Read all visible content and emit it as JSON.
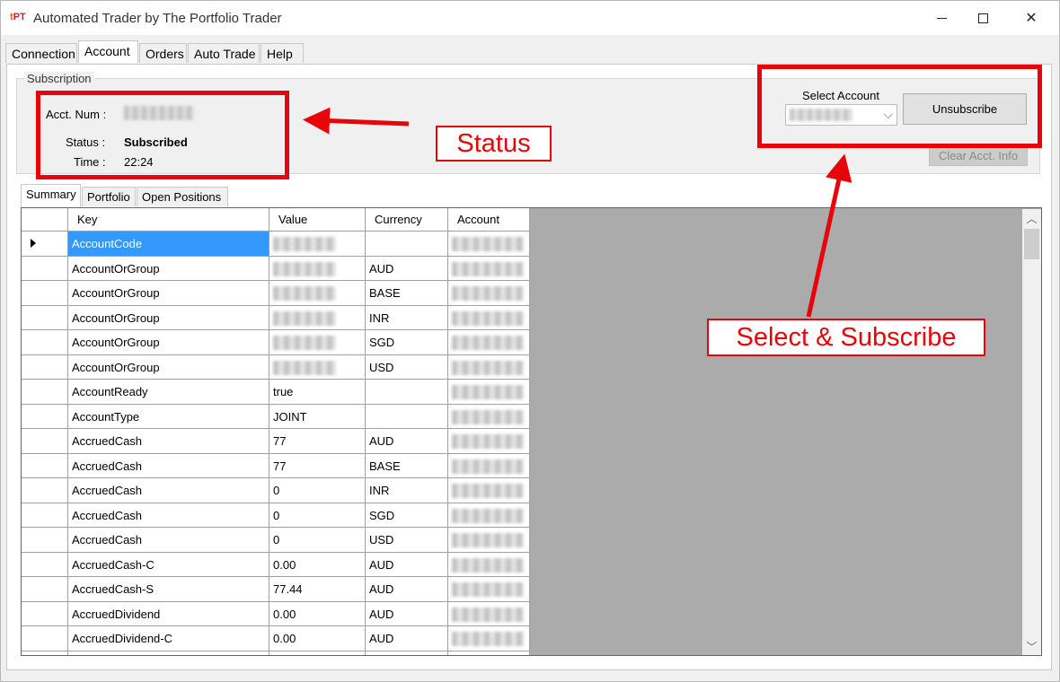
{
  "window": {
    "logo_a": "t",
    "logo_b": "PT",
    "title": "Automated Trader by The Portfolio Trader"
  },
  "tabs": [
    {
      "label": "Connection"
    },
    {
      "label": "Account"
    },
    {
      "label": "Orders"
    },
    {
      "label": "Auto Trade"
    },
    {
      "label": "Help"
    }
  ],
  "subscription": {
    "legend": "Subscription",
    "acct_num_label": "Acct. Num :",
    "status_label": "Status :",
    "status_value": "Subscribed",
    "time_label": "Time :",
    "time_value": "22:24",
    "select_account_label": "Select Account",
    "unsubscribe_label": "Unsubscribe",
    "clear_label": "Clear Acct. Info"
  },
  "subtabs": [
    {
      "label": "Summary"
    },
    {
      "label": "Portfolio"
    },
    {
      "label": "Open Positions"
    }
  ],
  "grid": {
    "columns": [
      "Key",
      "Value",
      "Currency",
      "Account"
    ],
    "rows": [
      {
        "key": "AccountCode",
        "value": "",
        "currency": ""
      },
      {
        "key": "AccountOrGroup",
        "value": "",
        "currency": "AUD"
      },
      {
        "key": "AccountOrGroup",
        "value": "",
        "currency": "BASE"
      },
      {
        "key": "AccountOrGroup",
        "value": "",
        "currency": "INR"
      },
      {
        "key": "AccountOrGroup",
        "value": "",
        "currency": "SGD"
      },
      {
        "key": "AccountOrGroup",
        "value": "",
        "currency": "USD"
      },
      {
        "key": "AccountReady",
        "value": "true",
        "currency": ""
      },
      {
        "key": "AccountType",
        "value": "JOINT",
        "currency": ""
      },
      {
        "key": "AccruedCash",
        "value": "77",
        "currency": "AUD"
      },
      {
        "key": "AccruedCash",
        "value": "77",
        "currency": "BASE"
      },
      {
        "key": "AccruedCash",
        "value": "0",
        "currency": "INR"
      },
      {
        "key": "AccruedCash",
        "value": "0",
        "currency": "SGD"
      },
      {
        "key": "AccruedCash",
        "value": "0",
        "currency": "USD"
      },
      {
        "key": "AccruedCash-C",
        "value": "0.00",
        "currency": "AUD"
      },
      {
        "key": "AccruedCash-S",
        "value": "77.44",
        "currency": "AUD"
      },
      {
        "key": "AccruedDividend",
        "value": "0.00",
        "currency": "AUD"
      },
      {
        "key": "AccruedDividend-C",
        "value": "0.00",
        "currency": "AUD"
      },
      {
        "key": "",
        "value": "",
        "currency": ""
      }
    ]
  },
  "annotations": {
    "status": "Status",
    "select_subscribe": "Select & Subscribe",
    "color": "#e8050a"
  },
  "colors": {
    "selection": "#3399ff",
    "window_bg": "#f0f0f0"
  }
}
